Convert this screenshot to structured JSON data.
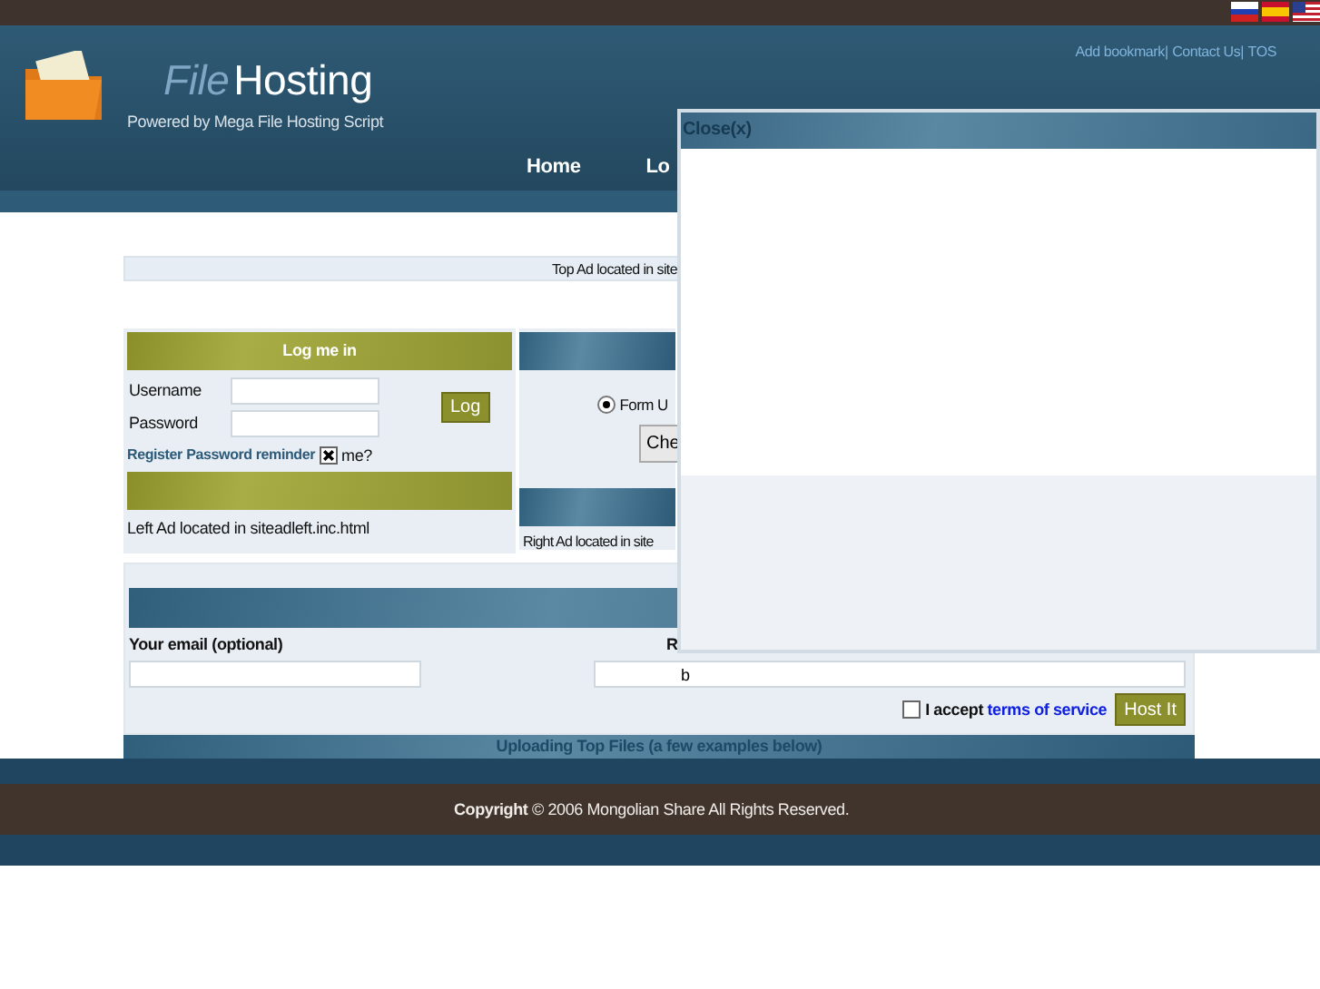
{
  "language_flags": [
    {
      "kind": "ru"
    },
    {
      "kind": "es"
    },
    {
      "kind": "en"
    }
  ],
  "header": {
    "title_part1": "File",
    "title_part2": "Hosting",
    "tagline": "Powered by Mega File Hosting Script",
    "links": [
      {
        "label": "Add bookmark",
        "separator": "|"
      },
      {
        "label": "Contact Us",
        "separator": "|"
      },
      {
        "label": "TOS"
      }
    ]
  },
  "nav": [
    "Home",
    "Lo"
  ],
  "top_ad": "Top Ad located in site",
  "login": {
    "title": "Log me in",
    "username_label": "Username",
    "password_label": "Password",
    "button": "Log",
    "links": [
      "Register",
      "Password reminder"
    ],
    "remember": {
      "checked": true,
      "label": "me?"
    }
  },
  "left_ad": "Left Ad located in siteadleft.inc.html",
  "upload_type": {
    "radio": {
      "label": "Form U",
      "selected": true
    },
    "button": "Che"
  },
  "right_ad": "Right Ad located in site",
  "upload_form": {
    "email_label": "Your email (optional)",
    "second_label": "R",
    "second_value": "b",
    "terms": {
      "checked": false,
      "prefix": "I accept",
      "link": "terms of service"
    },
    "button": "Host It"
  },
  "top_files_bar": "Uploading Top Files (a few examples below)",
  "footer": "**Copyright** © 2006 Mongolian Share All Rights Reserved.",
  "popup": {
    "close": "Close(x)"
  }
}
